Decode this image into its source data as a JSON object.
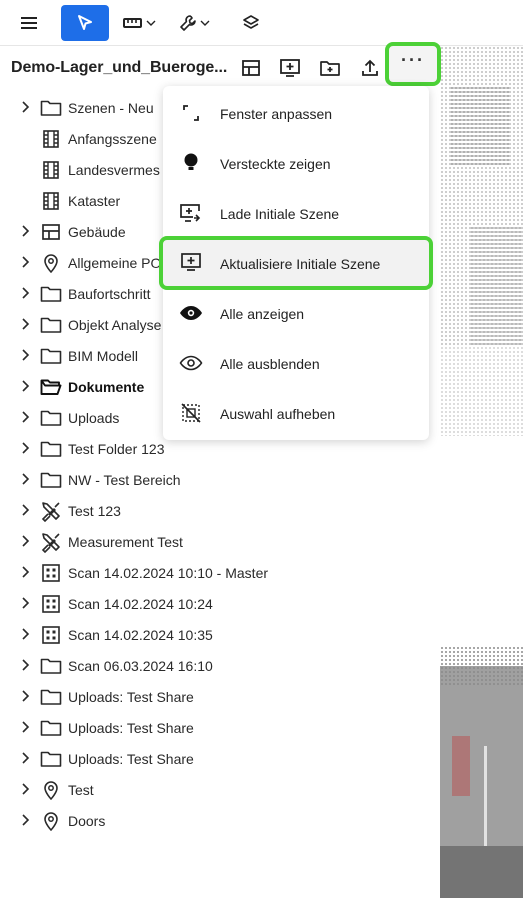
{
  "toolbar": {
    "buttons": [
      {
        "name": "menu",
        "icon": "hamburger-icon"
      },
      {
        "name": "select",
        "icon": "cursor-arrow-icon",
        "active": true
      },
      {
        "name": "measure",
        "icon": "ruler-icon"
      },
      {
        "name": "tools",
        "icon": "wrench-icon"
      },
      {
        "name": "layers",
        "icon": "layers-icon"
      }
    ],
    "accent_color": "#1e6ee8"
  },
  "project": {
    "title": "Demo-Lager_und_Buerogе...",
    "actions": [
      "layout-icon",
      "monitor-plus-icon",
      "folder-plus-icon",
      "upload-icon",
      "more-icon"
    ],
    "more_label": "···"
  },
  "highlight_color": "#4cd137",
  "tree": {
    "items": [
      {
        "label": "Szenen - Neu",
        "icon": "folder-icon",
        "expandable": true,
        "bold": false
      },
      {
        "label": "Anfangsszene",
        "icon": "film-icon",
        "expandable": false,
        "bold": false
      },
      {
        "label": "Landesvermes",
        "icon": "film-icon",
        "expandable": false,
        "bold": false
      },
      {
        "label": "Kataster",
        "icon": "film-icon",
        "expandable": false,
        "bold": false
      },
      {
        "label": "Gebäude",
        "icon": "building-grid-icon",
        "expandable": true,
        "bold": false
      },
      {
        "label": "Allgemeine PO",
        "icon": "pin-icon",
        "expandable": true,
        "bold": false
      },
      {
        "label": "Baufortschritt",
        "icon": "folder-icon",
        "expandable": true,
        "bold": false
      },
      {
        "label": "Objekt Analyse",
        "icon": "folder-icon",
        "expandable": true,
        "bold": false
      },
      {
        "label": "BIM Modell",
        "icon": "folder-icon",
        "expandable": true,
        "bold": false
      },
      {
        "label": "Dokumente",
        "icon": "folder-open-icon",
        "expandable": true,
        "bold": true
      },
      {
        "label": "Uploads",
        "icon": "folder-icon",
        "expandable": true,
        "bold": false
      },
      {
        "label": "Test Folder 123",
        "icon": "folder-icon",
        "expandable": true,
        "bold": false
      },
      {
        "label": "NW - Test Bereich",
        "icon": "folder-icon",
        "expandable": true,
        "bold": false
      },
      {
        "label": "Test 123",
        "icon": "tools-cross-icon",
        "expandable": true,
        "bold": false
      },
      {
        "label": "Measurement Test",
        "icon": "tools-cross-icon",
        "expandable": true,
        "bold": false
      },
      {
        "label": "Scan 14.02.2024 10:10 - Master",
        "icon": "scan-grid-icon",
        "expandable": true,
        "bold": false
      },
      {
        "label": "Scan 14.02.2024 10:24",
        "icon": "scan-grid-icon",
        "expandable": true,
        "bold": false
      },
      {
        "label": "Scan 14.02.2024 10:35",
        "icon": "scan-grid-icon",
        "expandable": true,
        "bold": false
      },
      {
        "label": "Scan 06.03.2024 16:10",
        "icon": "folder-icon",
        "expandable": true,
        "bold": false
      },
      {
        "label": "Uploads: Test Share",
        "icon": "folder-icon",
        "expandable": true,
        "bold": false
      },
      {
        "label": "Uploads: Test Share",
        "icon": "folder-icon",
        "expandable": true,
        "bold": false
      },
      {
        "label": "Uploads: Test Share",
        "icon": "folder-icon",
        "expandable": true,
        "bold": false
      },
      {
        "label": "Test",
        "icon": "pin-icon",
        "expandable": true,
        "bold": false
      },
      {
        "label": "Doors",
        "icon": "pin-icon",
        "expandable": true,
        "bold": false
      }
    ]
  },
  "menu": {
    "items": [
      {
        "label": "Fenster anpassen",
        "icon": "fit-window-icon",
        "highlighted": false
      },
      {
        "label": "Versteckte zeigen",
        "icon": "bulb-icon",
        "highlighted": false
      },
      {
        "label": "Lade Initiale Szene",
        "icon": "load-scene-icon",
        "highlighted": false
      },
      {
        "label": "Aktualisiere Initiale Szene",
        "icon": "update-scene-icon",
        "highlighted": true
      },
      {
        "label": "Alle anzeigen",
        "icon": "eye-filled-icon",
        "highlighted": false
      },
      {
        "label": "Alle ausblenden",
        "icon": "eye-outline-icon",
        "highlighted": false
      },
      {
        "label": "Auswahl aufheben",
        "icon": "deselect-icon",
        "highlighted": false
      }
    ]
  }
}
